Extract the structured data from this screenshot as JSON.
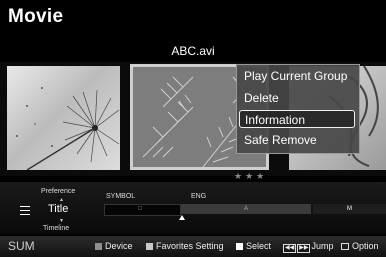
{
  "header": {
    "title": "Movie",
    "file_name": "ABC.avi"
  },
  "thumbnails": {
    "rating_stars": "★★★"
  },
  "context_menu": {
    "items": [
      {
        "label": "Play Current Group",
        "selected": false
      },
      {
        "label": "Delete",
        "selected": false
      },
      {
        "label": "Information",
        "selected": true
      },
      {
        "label": "Safe Remove",
        "selected": false
      }
    ]
  },
  "sort_panel": {
    "preference_label": "Preference",
    "current_sort": "Title",
    "timeline_label": "Timeline",
    "symbol_label": "SYMBOL",
    "eng_label": "ENG",
    "index_marks": [
      "□",
      "A",
      "M"
    ]
  },
  "bottom_bar": {
    "sum_label": "SUM",
    "device_label": "Device",
    "favorites_label": "Favorites Setting",
    "select_label": "Select",
    "jump_label": "Jump",
    "option_label": "Option"
  },
  "colors": {
    "background": "#000000",
    "menu_background": "#464646",
    "selection_border": "#f0f0f0",
    "panel": "#1a1a1a"
  }
}
